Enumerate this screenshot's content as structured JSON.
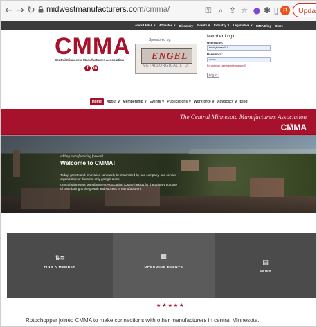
{
  "browser": {
    "url_host": "midwestmanufacturers.com",
    "url_path": "/cmma/",
    "update_label": "Update",
    "profile_initial": "B"
  },
  "topnav": {
    "items": [
      "About MMA ∨",
      "Affiliates ∨",
      "Directory",
      "Events ∨",
      "Industry ∨",
      "Legislative ∨",
      "MMA Blog",
      "Store"
    ]
  },
  "logo": {
    "acronym": "CMMA",
    "subtitle": "Central Minnesota Manufacturers Association"
  },
  "sponsor": {
    "label": "Sponsored by:",
    "name": "ENGEL",
    "subname": "METALLURGICAL LTD."
  },
  "login": {
    "title": "Member Login",
    "username_label": "Username:",
    "username_value": "beckyhoaas910",
    "password_label": "Password:",
    "password_value": "•••••••",
    "forgot": "Forgot your username/password?",
    "button": "Log In"
  },
  "mainnav": {
    "items": [
      "Home",
      "About ∨",
      "Membership ∨",
      "Events ∨",
      "Publications ∨",
      "Workforce ∨",
      "Advocacy ∨",
      "Blog"
    ]
  },
  "banner": {
    "subtitle": "The Central Minnesota Manufacturers Association",
    "title": "CMMA",
    "chevron": "∨"
  },
  "hero": {
    "tagline": "adding manufacturing forward",
    "heading": "Welcome to CMMA!",
    "paragraph1": "Today, growth and innovation can rarely be maximized by one company, one service organization or does not only going it alone.",
    "paragraph2": "Central Minnesota Manufacturers Association (CMMA) exists for the primary purpose of contributing to the growth and success of manufacturers."
  },
  "tiles": [
    {
      "icon": "list-icon",
      "glyph": "⇅≡",
      "label": "FIND A MEMBER",
      "color": "#4a4a4a"
    },
    {
      "icon": "calendar-icon",
      "glyph": "▦",
      "label": "UPCOMING EVENTS",
      "color": "#5a5a5a"
    },
    {
      "icon": "news-icon",
      "glyph": "▤",
      "label": "NEWS",
      "color": "#4a4a4a"
    }
  ],
  "stars": [
    "★",
    "★",
    "★",
    "★",
    "★"
  ],
  "testimonial": "Rotochopper joined CMMA to make connections with other manufacturers in central Minnesota.",
  "colors": {
    "brand": "#a6112c",
    "topnav": "#3b3b3b"
  }
}
